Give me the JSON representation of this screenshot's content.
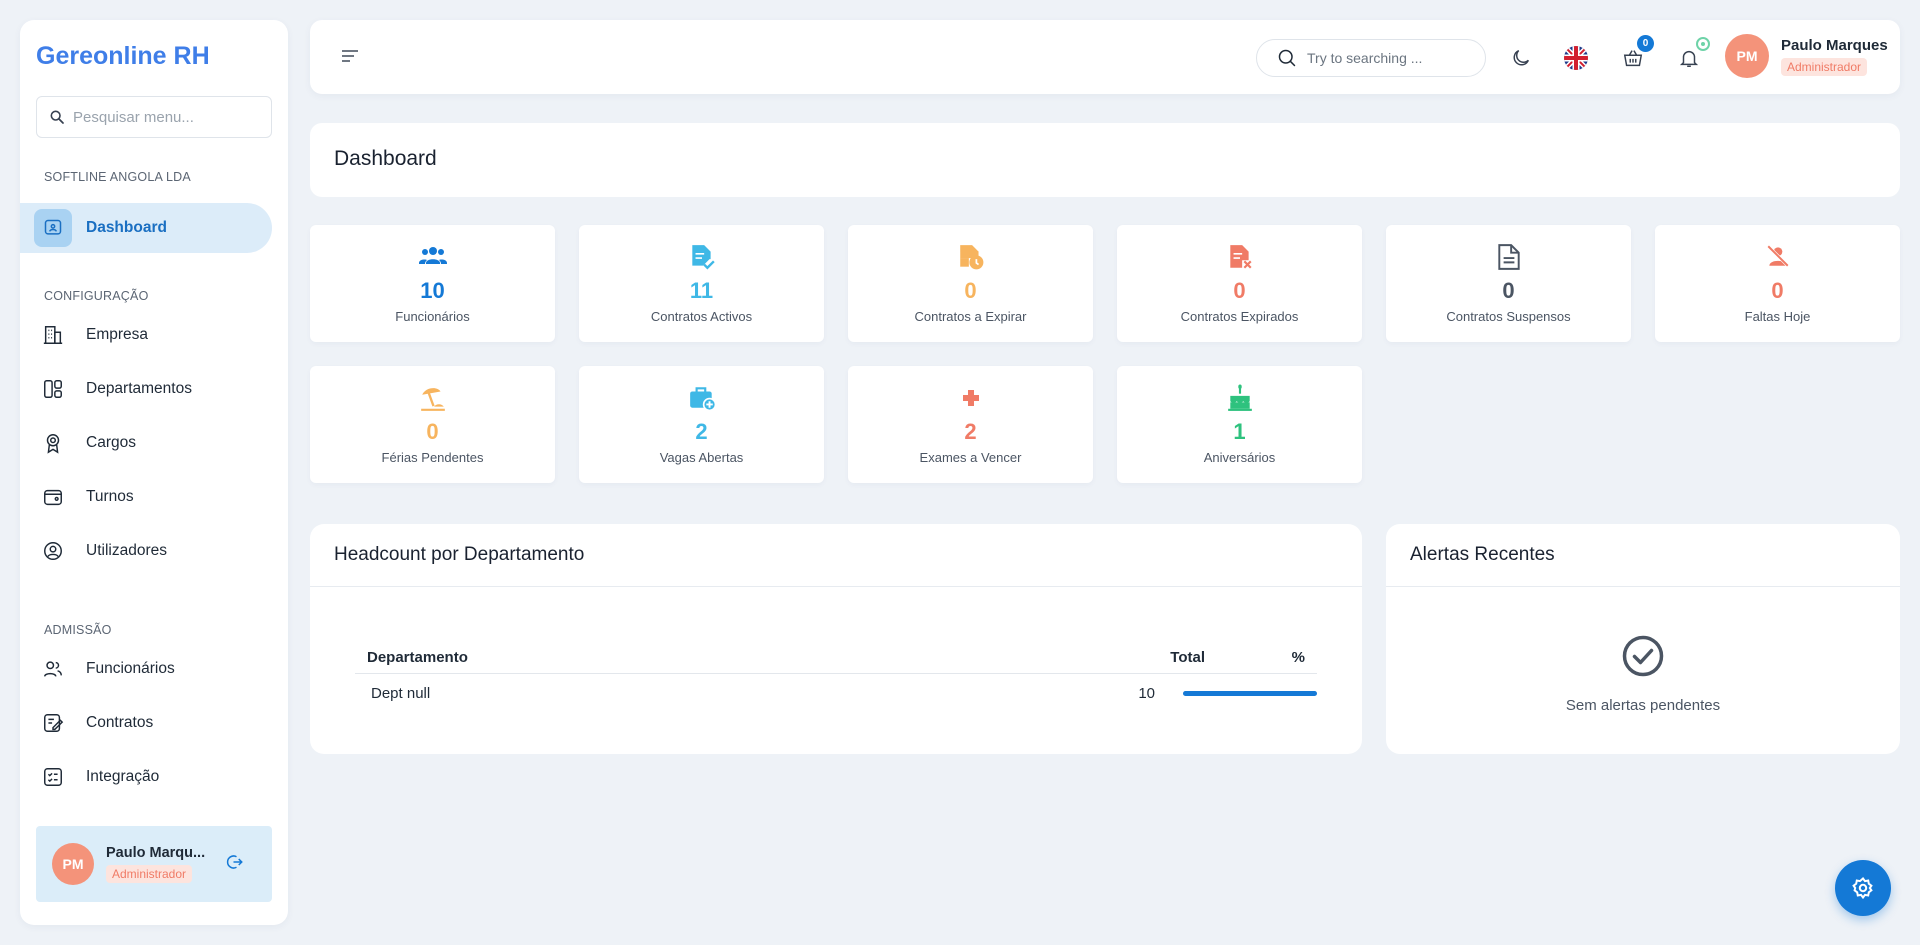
{
  "sidebar": {
    "brand": "Gereonline RH",
    "search_placeholder": "Pesquisar menu...",
    "company_label": "SOFTLINE ANGOLA LDA",
    "dashboard_label": "Dashboard",
    "config_label": "CONFIGURAÇÃO",
    "config_items": [
      "Empresa",
      "Departamentos",
      "Cargos",
      "Turnos",
      "Utilizadores"
    ],
    "admission_label": "ADMISSÃO",
    "admission_items": [
      "Funcionários",
      "Contratos",
      "Integração"
    ],
    "user": {
      "initials": "PM",
      "name": "Paulo Marqu...",
      "role": "Administrador"
    }
  },
  "topbar": {
    "search_placeholder": "Try to searching ...",
    "cart_count": "0",
    "user": {
      "initials": "PM",
      "name": "Paulo Marques",
      "role": "Administrador"
    }
  },
  "page": {
    "title": "Dashboard"
  },
  "stats": [
    {
      "value": "10",
      "label": "Funcionários",
      "color": "#1479d6",
      "icon": "users-icon"
    },
    {
      "value": "11",
      "label": "Contratos Activos",
      "color": "#3fb8e6",
      "icon": "file-check-icon"
    },
    {
      "value": "0",
      "label": "Contratos a Expirar",
      "color": "#f7b45e",
      "icon": "file-clock-icon"
    },
    {
      "value": "0",
      "label": "Contratos Expirados",
      "color": "#f07b66",
      "icon": "file-x-icon"
    },
    {
      "value": "0",
      "label": "Contratos Suspensos",
      "color": "#4b5563",
      "icon": "file-icon"
    },
    {
      "value": "0",
      "label": "Faltas Hoje",
      "color": "#f07b66",
      "icon": "user-off-icon"
    },
    {
      "value": "0",
      "label": "Férias Pendentes",
      "color": "#f7b45e",
      "icon": "beach-icon"
    },
    {
      "value": "2",
      "label": "Vagas Abertas",
      "color": "#3fb8e6",
      "icon": "briefcase-plus-icon"
    },
    {
      "value": "2",
      "label": "Exames a Vencer",
      "color": "#f07b66",
      "icon": "medical-cross-icon"
    },
    {
      "value": "1",
      "label": "Aniversários",
      "color": "#2ec27e",
      "icon": "cake-icon"
    }
  ],
  "headcount": {
    "title": "Headcount por Departamento",
    "columns": [
      "Departamento",
      "Total",
      "%"
    ],
    "rows": [
      {
        "department": "Dept null",
        "total": "10",
        "percent": 100
      }
    ]
  },
  "alerts": {
    "title": "Alertas Recentes",
    "empty_text": "Sem alertas pendentes"
  }
}
